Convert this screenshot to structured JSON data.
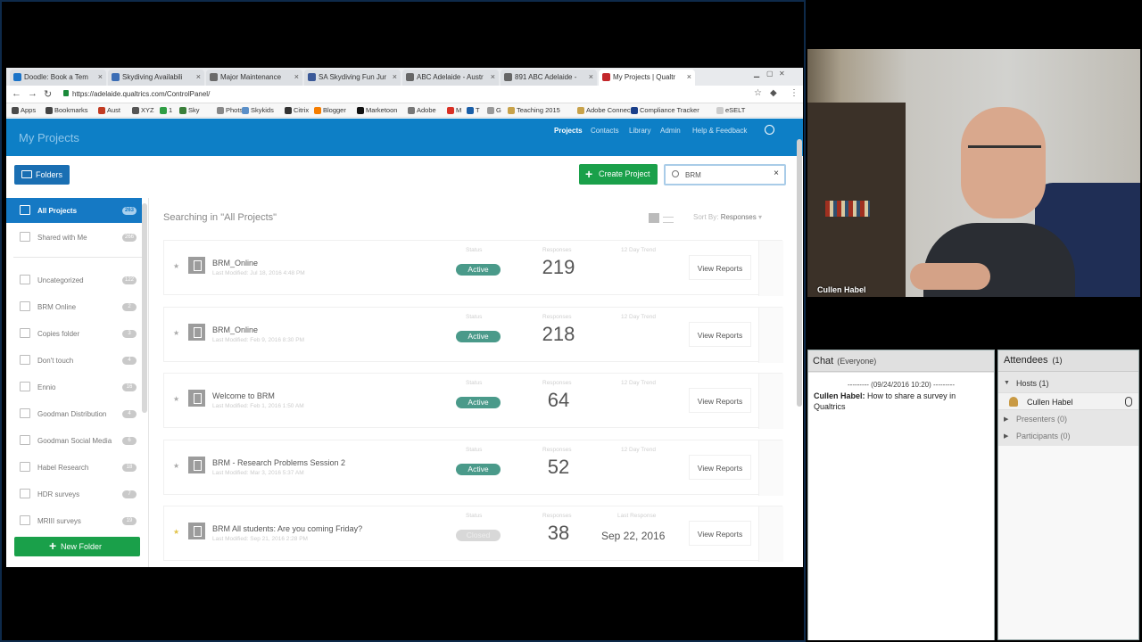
{
  "browser": {
    "tabs": [
      {
        "label": "Doodle: Book a Tem",
        "color": "#1a73c8"
      },
      {
        "label": "Skydiving Availabili",
        "color": "#3b6db5"
      },
      {
        "label": "Major Maintenance",
        "color": "#6a6a6a"
      },
      {
        "label": "SA Skydiving Fun Jur",
        "color": "#3b5998"
      },
      {
        "label": "ABC Adelaide - Austr",
        "color": "#666666"
      },
      {
        "label": "891 ABC Adelaide -",
        "color": "#666666"
      },
      {
        "label": "My Projects | Qualtr",
        "color": "#c3272b"
      }
    ],
    "url": "https://adelaide.qualtrics.com/ControlPanel/",
    "bookmarks": [
      {
        "label": "Apps",
        "color": "#4a4a4a"
      },
      {
        "label": "Bookmarks",
        "color": "#444444"
      },
      {
        "label": "Aust",
        "color": "#c23b22"
      },
      {
        "label": "XYZ",
        "color": "#555555"
      },
      {
        "label": "1",
        "color": "#2f9e44"
      },
      {
        "label": "Sky",
        "color": "#3a7f3a"
      },
      {
        "label": "Phots",
        "color": "#888888"
      },
      {
        "label": "Skykids",
        "color": "#5a8fc8"
      },
      {
        "label": "Citrix",
        "color": "#333333"
      },
      {
        "label": "Blogger",
        "color": "#f57d00"
      },
      {
        "label": "Marketoon",
        "color": "#111111"
      },
      {
        "label": "Adobe",
        "color": "#777777"
      },
      {
        "label": "M",
        "color": "#d93025"
      },
      {
        "label": "T",
        "color": "#1a5fa8"
      },
      {
        "label": "G",
        "color": "#999999"
      },
      {
        "label": "Teaching 2015",
        "color": "#c8a24a"
      },
      {
        "label": "Adobe Connect",
        "color": "#c8a24a"
      },
      {
        "label": "Compliance Tracker",
        "color": "#1a3f8a"
      },
      {
        "label": "eSELT",
        "color": "#cccccc"
      }
    ]
  },
  "qualtrics": {
    "title": "My Projects",
    "nav": [
      "Projects",
      "Contacts",
      "Library",
      "Admin",
      "Help & Feedback"
    ],
    "folders_label": "Folders",
    "create_label": "Create Project",
    "search_value": "BRM",
    "searching_text": "Searching in \"All Projects\"",
    "sort_prefix": "Sort By:",
    "sort_value": "Responses",
    "new_folder_label": "New Folder",
    "sidebar": [
      {
        "label": "All Projects",
        "count": "263"
      },
      {
        "label": "Shared with Me",
        "count": "266"
      },
      {
        "label": "Uncategorized",
        "count": "122"
      },
      {
        "label": "BRM Online",
        "count": "2"
      },
      {
        "label": "Copies folder",
        "count": "3"
      },
      {
        "label": "Don't touch",
        "count": "4"
      },
      {
        "label": "Ennio",
        "count": "16"
      },
      {
        "label": "Goodman Distribution",
        "count": "4"
      },
      {
        "label": "Goodman Social Media",
        "count": "6"
      },
      {
        "label": "Habel Research",
        "count": "18"
      },
      {
        "label": "HDR surveys",
        "count": "7"
      },
      {
        "label": "MRIII surveys",
        "count": "19"
      }
    ],
    "col_labels": {
      "status": "Status",
      "responses": "Responses",
      "trend": "12 Day Trend",
      "last": "Last Response"
    },
    "projects": [
      {
        "name": "BRM_Online",
        "modified": "Last Modified: Jul 18, 2016 4:48 PM",
        "status": "Active",
        "responses": "219",
        "last_response": "",
        "view": "View Reports"
      },
      {
        "name": "BRM_Online",
        "modified": "Last Modified: Feb 9, 2016 8:30 PM",
        "status": "Active",
        "responses": "218",
        "last_response": "",
        "view": "View Reports"
      },
      {
        "name": "Welcome to BRM",
        "modified": "Last Modified: Feb 1, 2016 1:50 AM",
        "status": "Active",
        "responses": "64",
        "last_response": "",
        "view": "View Reports"
      },
      {
        "name": "BRM - Research Problems Session 2",
        "modified": "Last Modified: Mar 3, 2016 5:37 AM",
        "status": "Active",
        "responses": "52",
        "last_response": "",
        "view": "View Reports"
      },
      {
        "name": "BRM All students: Are you coming Friday?",
        "modified": "Last Modified: Sep 21, 2016 2:28 PM",
        "status": "Closed",
        "responses": "38",
        "last_response": "Sep 22, 2016",
        "view": "View Reports"
      }
    ]
  },
  "video": {
    "name": "Cullen Habel"
  },
  "chat": {
    "title": "Chat",
    "audience": "(Everyone)",
    "timestamp": "--------- (09/24/2016 10:20) ---------",
    "sender": "Cullen Habel:",
    "message": "How to share a survey in Qualtrics"
  },
  "attendees": {
    "title": "Attendees",
    "count": "(1)",
    "hosts": "Hosts (1)",
    "host_name": "Cullen Habel",
    "presenters": "Presenters (0)",
    "participants": "Participants (0)"
  }
}
